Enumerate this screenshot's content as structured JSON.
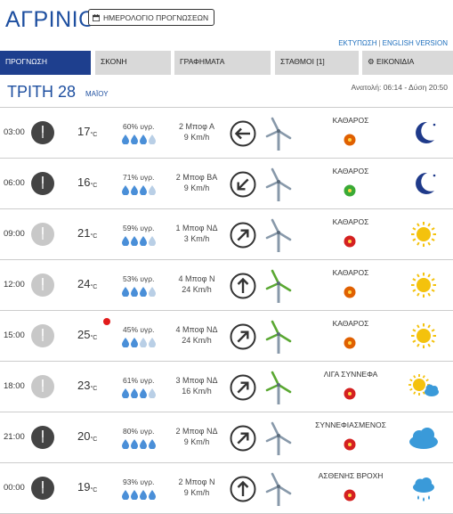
{
  "city": "ΑΓΡΙΝΙΟ",
  "calendar_button": "ΗΜΕΡΟΛΟΓΙΟ ΠΡΟΓΝΩΣΕΩΝ",
  "links": {
    "print": "ΕΚΤΥΠΩΣΗ",
    "english": "ENGLISH VERSION"
  },
  "tabs": [
    "ΠΡΟΓΝΩΣΗ",
    "ΣΚΟΝΗ",
    "ΓΡΑΦΗΜΑΤΑ",
    "ΣΤΑΘΜΟΙ [1]",
    "ΕΙΚΟΝΙΔΙΑ"
  ],
  "day": {
    "name": "ΤΡΙΤΗ 28",
    "month": "ΜΑΪΟΥ",
    "sun": "Ανατολή: 06:14 - Δύση 20:50"
  },
  "colors": {
    "brand_blue": "#1e4fa0",
    "tab_active": "#1e3f8e",
    "uv_red": "#d42020",
    "uv_orange": "#e06000",
    "uv_green": "#3aaa35",
    "drop": "#4a8fd8",
    "alert": "#e21b1b"
  },
  "rows": [
    {
      "time": "03:00",
      "clock": "night",
      "temp": "17",
      "unit": "°C",
      "humidity": "60% υγρ.",
      "drops_filled": 3,
      "wind_force": "2 Μποφ Α",
      "wind_speed": "9 Km/h",
      "direction_icon": "arrow-left-icon",
      "turbine": "turbine-gray-icon",
      "condition": "ΚΑΘΑΡΟΣ",
      "uv": "uv-orange-icon",
      "weather_icon": "moon-icon",
      "alert": false
    },
    {
      "time": "06:00",
      "clock": "night",
      "temp": "16",
      "unit": "°C",
      "humidity": "71% υγρ.",
      "drops_filled": 3,
      "wind_force": "2 Μποφ ΒΑ",
      "wind_speed": "9 Km/h",
      "direction_icon": "arrow-down-left-icon",
      "turbine": "turbine-gray-icon",
      "condition": "ΚΑΘΑΡΟΣ",
      "uv": "uv-green-icon",
      "weather_icon": "moon-icon",
      "alert": false
    },
    {
      "time": "09:00",
      "clock": "day",
      "temp": "21",
      "unit": "°C",
      "humidity": "59% υγρ.",
      "drops_filled": 3,
      "wind_force": "1 Μποφ ΝΔ",
      "wind_speed": "3 Km/h",
      "direction_icon": "arrow-up-right-icon",
      "turbine": "turbine-gray-icon",
      "condition": "ΚΑΘΑΡΟΣ",
      "uv": "uv-red-icon",
      "weather_icon": "sun-icon",
      "alert": false
    },
    {
      "time": "12:00",
      "clock": "day",
      "temp": "24",
      "unit": "°C",
      "humidity": "53% υγρ.",
      "drops_filled": 3,
      "wind_force": "4 Μποφ Ν",
      "wind_speed": "24 Km/h",
      "direction_icon": "arrow-up-icon",
      "turbine": "turbine-green-icon",
      "condition": "ΚΑΘΑΡΟΣ",
      "uv": "uv-orange-icon",
      "weather_icon": "sun-icon",
      "alert": false
    },
    {
      "time": "15:00",
      "clock": "day",
      "temp": "25",
      "unit": "°C",
      "humidity": "45% υγρ.",
      "drops_filled": 2,
      "wind_force": "4 Μποφ ΝΔ",
      "wind_speed": "24 Km/h",
      "direction_icon": "arrow-up-right-icon",
      "turbine": "turbine-green-icon",
      "condition": "ΚΑΘΑΡΟΣ",
      "uv": "uv-orange-icon",
      "weather_icon": "sun-icon",
      "alert": true
    },
    {
      "time": "18:00",
      "clock": "day",
      "temp": "23",
      "unit": "°C",
      "humidity": "61% υγρ.",
      "drops_filled": 3,
      "wind_force": "3 Μποφ ΝΔ",
      "wind_speed": "16 Km/h",
      "direction_icon": "arrow-up-right-icon",
      "turbine": "turbine-green-icon",
      "condition": "ΛΙΓΑ ΣΥΝΝΕΦΑ",
      "uv": "uv-red-icon",
      "weather_icon": "sun-cloud-icon",
      "alert": false
    },
    {
      "time": "21:00",
      "clock": "night",
      "temp": "20",
      "unit": "°C",
      "humidity": "80% υγρ.",
      "drops_filled": 4,
      "wind_force": "2 Μποφ ΝΔ",
      "wind_speed": "9 Km/h",
      "direction_icon": "arrow-up-right-icon",
      "turbine": "turbine-gray-icon",
      "condition": "ΣΥΝΝΕΦΙΑΣΜΕΝΟΣ",
      "uv": "uv-red-icon",
      "weather_icon": "cloud-icon",
      "alert": false
    },
    {
      "time": "00:00",
      "clock": "night",
      "temp": "19",
      "unit": "°C",
      "humidity": "93% υγρ.",
      "drops_filled": 4,
      "wind_force": "2 Μποφ Ν",
      "wind_speed": "9 Km/h",
      "direction_icon": "arrow-up-icon",
      "turbine": "turbine-gray-icon",
      "condition": "ΑΣΘΕΝΗΣ ΒΡΟΧΗ",
      "uv": "uv-red-icon",
      "weather_icon": "rain-icon",
      "alert": false
    }
  ]
}
